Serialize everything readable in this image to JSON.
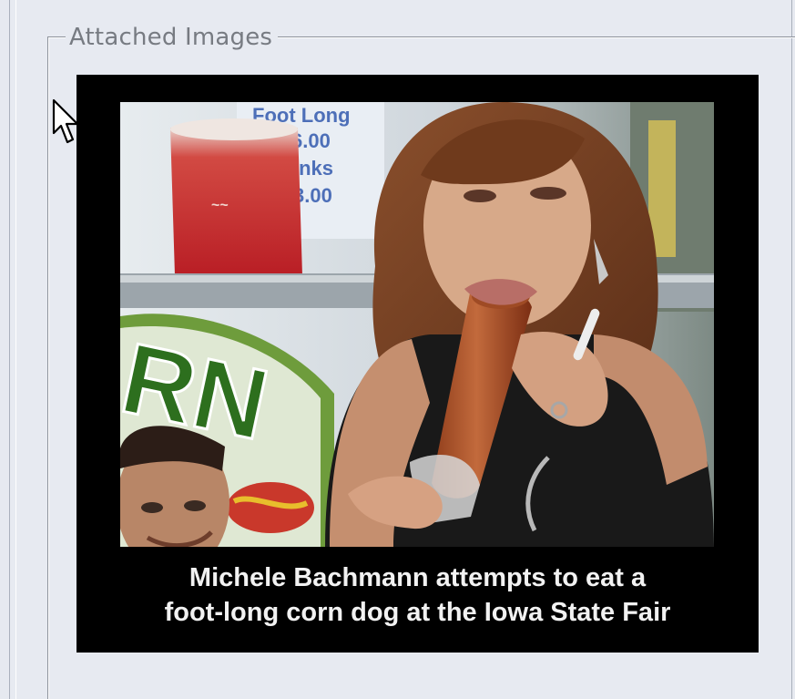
{
  "attachments_panel": {
    "legend": "Attached Images"
  },
  "attached_image": {
    "caption_line_1": "Michele Bachmann attempts to eat a",
    "caption_line_2": "foot-long corn dog at the Iowa State Fair",
    "sign": {
      "line_1": "Foot Long",
      "line_2": "6.00",
      "line_3": "inks",
      "line_4": "3.00"
    },
    "banner_text": "RN",
    "cup_text": "~~"
  }
}
